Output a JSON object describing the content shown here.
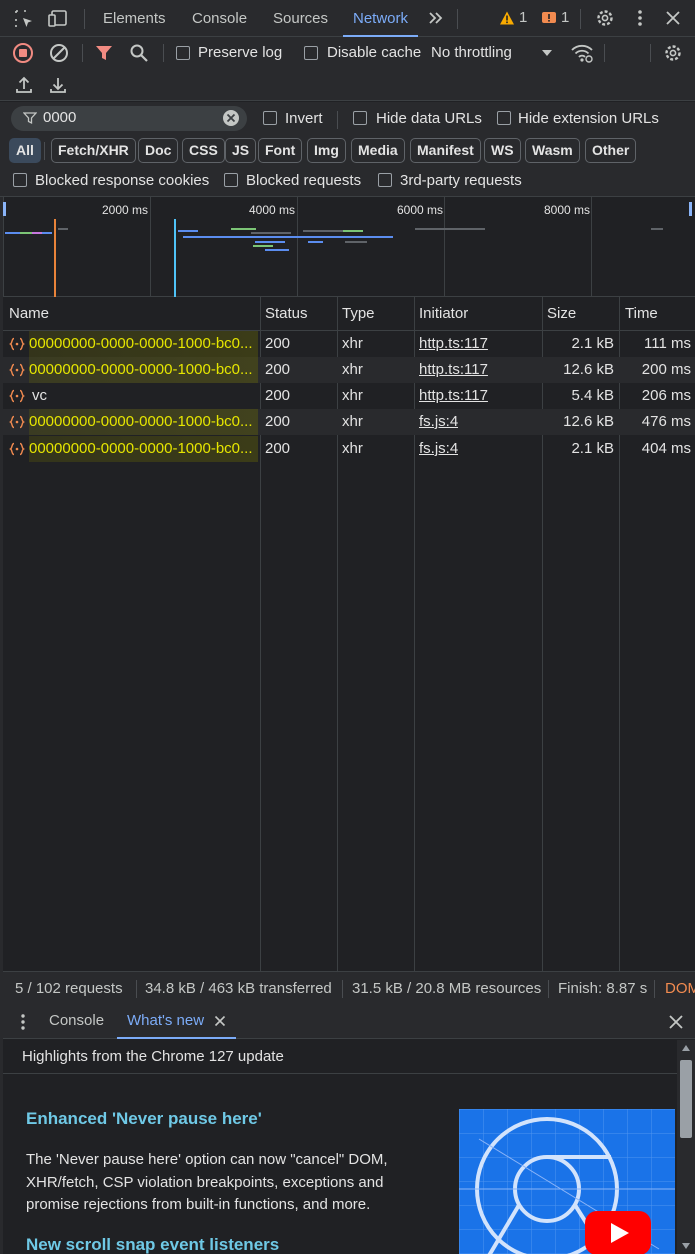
{
  "topbar": {
    "tabs": [
      "Elements",
      "Console",
      "Sources",
      "Network"
    ],
    "active_tab": "Network",
    "warning_count": "1",
    "error_count": "1"
  },
  "toolbar": {
    "preserve_log": "Preserve log",
    "disable_cache": "Disable cache",
    "throttling": "No throttling"
  },
  "filter": {
    "value": "0000",
    "invert": "Invert",
    "hide_data_urls": "Hide data URLs",
    "hide_extension_urls": "Hide extension URLs",
    "types": [
      "All",
      "Fetch/XHR",
      "Doc",
      "CSS",
      "JS",
      "Font",
      "Img",
      "Media",
      "Manifest",
      "WS",
      "Wasm",
      "Other"
    ],
    "blocked_response_cookies": "Blocked response cookies",
    "blocked_requests": "Blocked requests",
    "third_party": "3rd-party requests"
  },
  "overview": {
    "ticks": [
      "2000 ms",
      "4000 ms",
      "6000 ms",
      "8000 ms"
    ]
  },
  "grid": {
    "headers": [
      "Name",
      "Status",
      "Type",
      "Initiator",
      "Size",
      "Time"
    ],
    "rows": [
      {
        "name": "00000000-0000-0000-1000-bc0...",
        "status": "200",
        "type": "xhr",
        "initiator": "http.ts:117",
        "size": "2.1 kB",
        "time": "111 ms"
      },
      {
        "name": "00000000-0000-0000-1000-bc0...",
        "status": "200",
        "type": "xhr",
        "initiator": "http.ts:117",
        "size": "12.6 kB",
        "time": "200 ms"
      },
      {
        "name": "vc",
        "status": "200",
        "type": "xhr",
        "initiator": "http.ts:117",
        "size": "5.4 kB",
        "time": "206 ms"
      },
      {
        "name": "00000000-0000-0000-1000-bc0...",
        "status": "200",
        "type": "xhr",
        "initiator": "fs.js:4",
        "size": "12.6 kB",
        "time": "476 ms"
      },
      {
        "name": "00000000-0000-0000-1000-bc0...",
        "status": "200",
        "type": "xhr",
        "initiator": "fs.js:4",
        "size": "2.1 kB",
        "time": "404 ms"
      }
    ]
  },
  "status": {
    "requests": "5 / 102 requests",
    "transferred": "34.8 kB / 463 kB transferred",
    "resources": "31.5 kB / 20.8 MB resources",
    "finish": "Finish: 8.87 s",
    "dom": "DOM"
  },
  "drawer": {
    "tabs": [
      "Console",
      "What's new"
    ],
    "active_tab": "What's new",
    "highlights": "Highlights from the Chrome 127 update",
    "article1_title": "Enhanced 'Never pause here'",
    "article1_body": "The 'Never pause here' option can now \"cancel\" DOM, XHR/fetch, CSP violation breakpoints, exceptions and promise rejections from built-in functions, and more.",
    "article2_title": "New scroll snap event listeners"
  },
  "colors": {
    "accent": "#7cacf8",
    "highlight_name": "#e6e600",
    "link_teal": "#6fc9e6",
    "record_red": "#f28b82",
    "dom_orange": "#f28b50"
  }
}
